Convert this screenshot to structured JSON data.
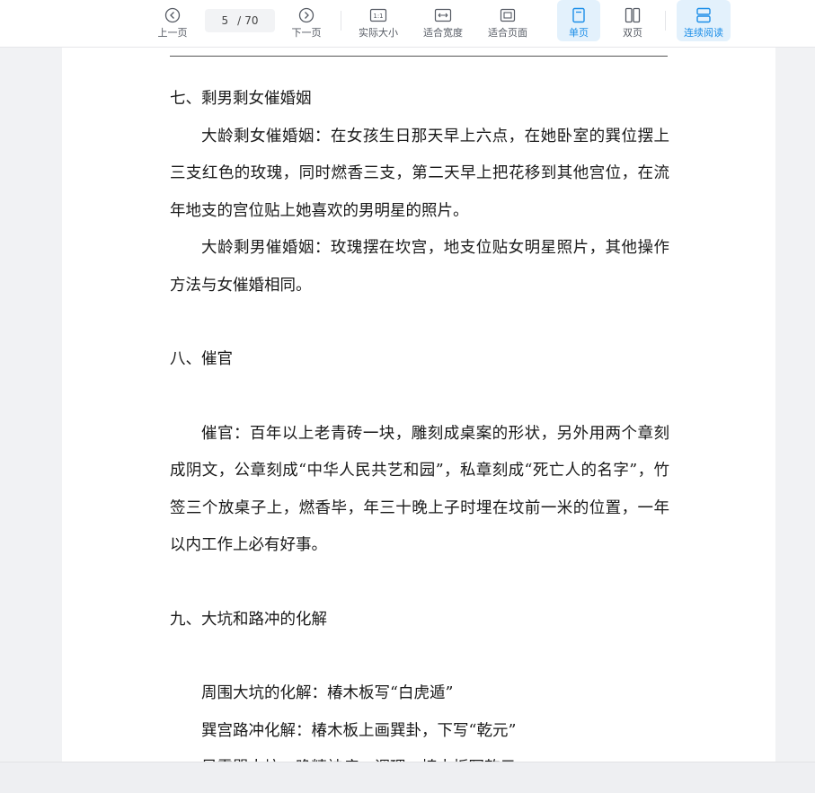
{
  "toolbar": {
    "prev_label": "上一页",
    "next_label": "下一页",
    "current_page": "5",
    "page_separator": "/",
    "total_pages": "70",
    "actual_size_label": "实际大小",
    "fit_width_label": "适合宽度",
    "fit_page_label": "适合页面",
    "single_page_label": "单页",
    "double_page_label": "双页",
    "continuous_label": "连续阅读",
    "accent_color": "#1c8ee8"
  },
  "document": {
    "sections": [
      {
        "heading": "七、剩男剩女催婚姻",
        "paragraphs": [
          "大龄剩女催婚姻：在女孩生日那天早上六点，在她卧室的巽位摆上三支红色的玫瑰，同时燃香三支，第二天早上把花移到其他宫位，在流年地支的宫位贴上她喜欢的男明星的照片。",
          "大龄剩男催婚姻：玫瑰摆在坎宫，地支位贴女明星照片，其他操作方法与女催婚相同。"
        ]
      },
      {
        "heading": "八、催官",
        "paragraphs": [
          "催官：百年以上老青砖一块，雕刻成桌案的形状，另外用两个章刻成阴文，公章刻成“中华人民共艺和园”，私章刻成“死亡人的名字”，竹签三个放桌子上，燃香毕，年三十晚上子时埋在坟前一米的位置，一年以内工作上必有好事。"
        ]
      },
      {
        "heading": "九、大坑和路冲的化解",
        "paragraphs": [
          "周围大坑的化解：椿木板写“白虎遁”",
          "巽宫路冲化解：椿木板上画巽卦，下写“乾元”",
          "另震巽大坑，晚精神病，调理，椿木板写乾元"
        ]
      }
    ]
  }
}
